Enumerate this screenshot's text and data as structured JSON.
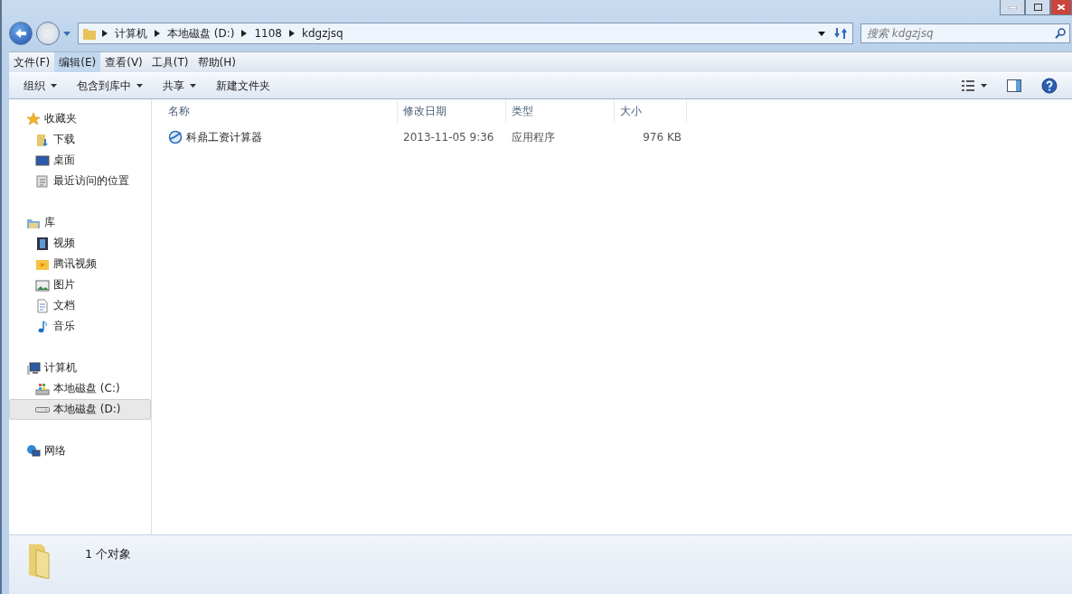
{
  "address": {
    "crumbs": [
      "计算机",
      "本地磁盘 (D:)",
      "1108",
      "kdgzjsq"
    ]
  },
  "search": {
    "placeholder": "搜索 kdgzjsq"
  },
  "menu": [
    {
      "label": "文件(F)",
      "selected": false
    },
    {
      "label": "编辑(E)",
      "selected": true
    },
    {
      "label": "查看(V)",
      "selected": false
    },
    {
      "label": "工具(T)",
      "selected": false
    },
    {
      "label": "帮助(H)",
      "selected": false
    }
  ],
  "toolbar": [
    {
      "label": "组织",
      "dropdown": true
    },
    {
      "label": "包含到库中",
      "dropdown": true
    },
    {
      "label": "共享",
      "dropdown": true
    },
    {
      "label": "新建文件夹",
      "dropdown": false
    }
  ],
  "sidebar": [
    {
      "label": "收藏夹",
      "kind": "star",
      "children": [
        {
          "label": "下载",
          "kind": "download",
          "selected": false
        },
        {
          "label": "桌面",
          "kind": "desktop",
          "selected": false
        },
        {
          "label": "最近访问的位置",
          "kind": "recent",
          "selected": false
        }
      ]
    },
    {
      "label": "库",
      "kind": "library",
      "children": [
        {
          "label": "视频",
          "kind": "video",
          "selected": false
        },
        {
          "label": "腾讯视频",
          "kind": "tencent",
          "selected": false
        },
        {
          "label": "图片",
          "kind": "picture",
          "selected": false
        },
        {
          "label": "文档",
          "kind": "document",
          "selected": false
        },
        {
          "label": "音乐",
          "kind": "music",
          "selected": false
        }
      ]
    },
    {
      "label": "计算机",
      "kind": "computer",
      "children": [
        {
          "label": "本地磁盘 (C:)",
          "kind": "drive-c",
          "selected": false
        },
        {
          "label": "本地磁盘 (D:)",
          "kind": "drive",
          "selected": true
        }
      ]
    },
    {
      "label": "网络",
      "kind": "network"
    }
  ],
  "table": {
    "columns": [
      "名称",
      "修改日期",
      "类型",
      "大小"
    ],
    "rows": [
      {
        "name": "科鼎工资计算器",
        "modified": "2013-11-05 9:36",
        "type": "应用程序",
        "size": "976 KB"
      }
    ]
  },
  "status_bar": {
    "text": "1 个对象"
  }
}
